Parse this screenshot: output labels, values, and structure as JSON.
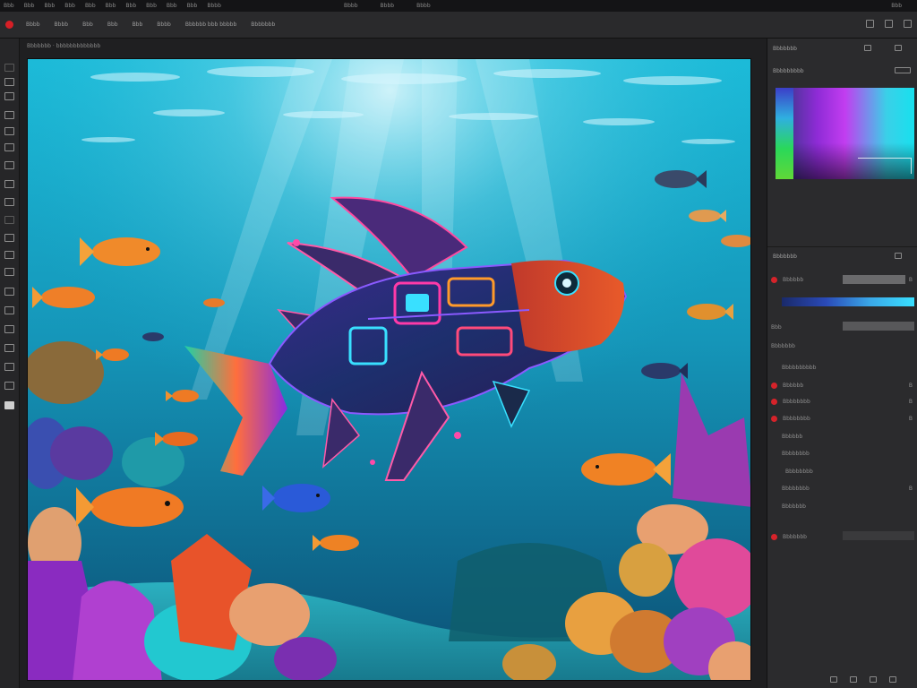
{
  "menu": {
    "items": [
      "Bbb",
      "Bbb",
      "Bbb",
      "Bbb",
      "Bbb",
      "Bbb",
      "Bbb",
      "Bbb",
      "Bbb",
      "Bbb",
      "Bbbb"
    ],
    "center": [
      "Bbbb",
      "Bbbb",
      "Bbbb"
    ],
    "right": "Bbb"
  },
  "options": {
    "items": [
      "Bbbb",
      "Bbbb",
      "Bbb",
      "Bbb",
      "Bbb",
      "Bbbb",
      "Bbbbbb bbb bbbbb",
      "Bbbbbbb"
    ]
  },
  "document": {
    "tab_label": "Bbbbbbb · bbbbbbbbbbbbb"
  },
  "panels": {
    "color_tab": "Bbbbbbb",
    "color_subtab": "Bbbbbbbbb",
    "adjust_tab": "Bbbbbbb",
    "adjust_rows": [
      {
        "label": "Bbbbbb",
        "value": "B"
      },
      {
        "label": "",
        "value": ""
      },
      {
        "label": "Bbb",
        "value": ""
      },
      {
        "label": "Bbbbbbb",
        "value": ""
      },
      {
        "label": "Bbbbbbbbbb",
        "value": ""
      },
      {
        "label": "Bbbbbb",
        "value": "B"
      },
      {
        "label": "Bbbbbbbb",
        "value": "B"
      },
      {
        "label": "Bbbbbbbb",
        "value": "B"
      },
      {
        "label": "Bbbbbb",
        "value": ""
      },
      {
        "label": "Bbbbbbbb",
        "value": ""
      },
      {
        "label": "Bbbbbbbb",
        "value": ""
      },
      {
        "label": "Bbbbbbbb",
        "value": "B"
      },
      {
        "label": "Bbbbbbb",
        "value": ""
      },
      {
        "label": "Bbbbbbb",
        "value": ""
      }
    ]
  },
  "colors": {
    "accent_red": "#d61f26",
    "panel_bg": "#2b2b2d",
    "water_top": "#1ab6d6",
    "water_bottom": "#0a4f76"
  },
  "icons": [
    "record-icon",
    "window-icon",
    "panel-icon",
    "layers-icon",
    "zoom-icon",
    "grid-icon"
  ]
}
